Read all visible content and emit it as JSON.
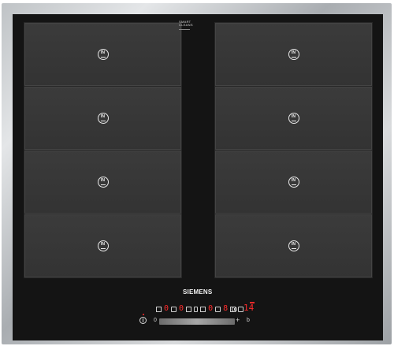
{
  "product": {
    "brand": "SIEMENS",
    "feature_badge": "SMART CLEANS"
  },
  "cooking_zones": [
    {
      "id": "front-left-top",
      "label": "IN"
    },
    {
      "id": "front-right-top",
      "label": "IN"
    },
    {
      "id": "left-2",
      "label": "IN"
    },
    {
      "id": "right-2",
      "label": "IN"
    },
    {
      "id": "left-3",
      "label": "IN"
    },
    {
      "id": "right-3",
      "label": "IN"
    },
    {
      "id": "left-4",
      "label": "IN"
    },
    {
      "id": "right-4",
      "label": "IN"
    }
  ],
  "controls": {
    "power_icon": "power-icon",
    "zone_displays": [
      "0",
      "0",
      "0"
    ],
    "active_zone_display": "8",
    "timer_display": "14",
    "slider_min_label": "0",
    "slider_max_label": "+",
    "boost_label": "b",
    "accent_red": "#ff2b2b"
  }
}
